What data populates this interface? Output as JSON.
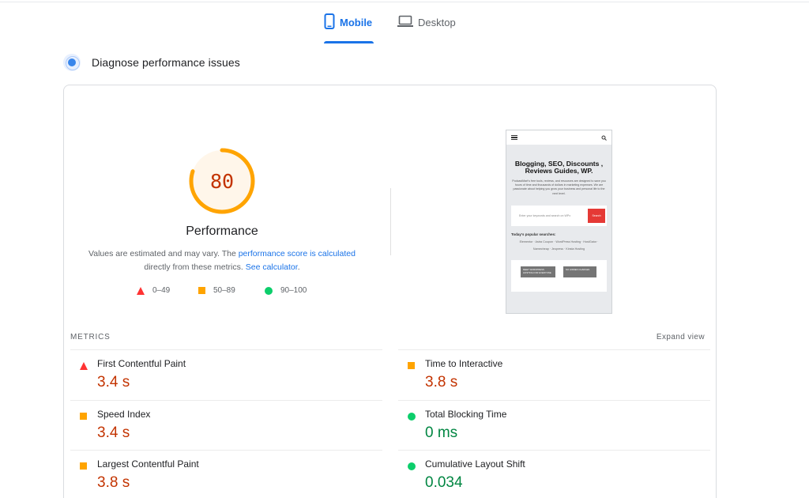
{
  "tabs": [
    {
      "label": "Mobile",
      "active": true,
      "icon": "smartphone-icon"
    },
    {
      "label": "Desktop",
      "active": false,
      "icon": "laptop-icon"
    }
  ],
  "diagnose": {
    "title": "Diagnose performance issues",
    "icon": "lighthouse-icon"
  },
  "performance": {
    "score": "80",
    "score_fraction": 0.8,
    "label": "Performance",
    "note_prefix": "Values are estimated and may vary. The ",
    "note_link1": "performance score is calculated",
    "note_middle": " directly from these metrics. ",
    "note_link2": "See calculator",
    "note_suffix": "."
  },
  "legend": [
    {
      "shape": "triangle",
      "range": "0–49",
      "color": "#ff3333"
    },
    {
      "shape": "square",
      "range": "50–89",
      "color": "#ffa400"
    },
    {
      "shape": "circle",
      "range": "90–100",
      "color": "#0cce6b"
    }
  ],
  "screenshot": {
    "title": "Blogging, SEO, Discounts , Reviews Guides, WP.",
    "description": "PodcastMart's free tools, reviews, and resources are designed to save you hours of time and thousands of dollars in marketing expenses. We are passionate about helping you grow your business and personal life to the next level.",
    "search_placeholder": "Enter your keywords and search on WPx",
    "search_button": "Search",
    "popular_heading": "Today's popular searches:",
    "popular_tags": "Elementor · Astra Coupon · WordPress Hosting · HostGator · Namecheap · Jeopress · Kinsta Hosting",
    "buttons": [
      "MEET WORDPRESS HOSTING FOR EVERYONE",
      "NO HIDDEN CHARGES"
    ]
  },
  "metrics": {
    "header": "METRICS",
    "expand_label": "Expand view",
    "items": [
      {
        "name": "First Contentful Paint",
        "value": "3.4 s",
        "rating": "poor"
      },
      {
        "name": "Time to Interactive",
        "value": "3.8 s",
        "rating": "average"
      },
      {
        "name": "Speed Index",
        "value": "3.4 s",
        "rating": "average"
      },
      {
        "name": "Total Blocking Time",
        "value": "0 ms",
        "rating": "good"
      },
      {
        "name": "Largest Contentful Paint",
        "value": "3.8 s",
        "rating": "average"
      },
      {
        "name": "Cumulative Layout Shift",
        "value": "0.034",
        "rating": "good"
      }
    ]
  },
  "colors": {
    "accent": "#1a73e8",
    "poor": "#ff3333",
    "average": "#ffa400",
    "good": "#0cce6b",
    "score_text": "#c33300",
    "value_red": "#c33300",
    "value_green": "#018642"
  }
}
